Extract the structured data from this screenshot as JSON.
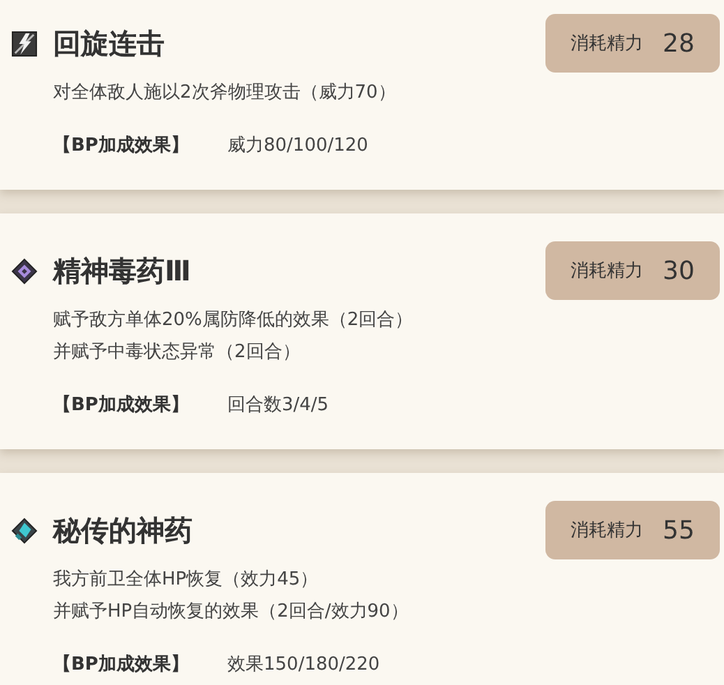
{
  "skills": [
    {
      "kind": "physical",
      "name": "回旋连击",
      "cost_label": "消耗精力",
      "cost": "28",
      "description": [
        "对全体敌人施以2次斧物理攻击（威力70）"
      ],
      "bp_label": "【BP加成效果】",
      "bp_value": "威力80/100/120"
    },
    {
      "kind": "debuff",
      "name": "精神毒药Ⅲ",
      "cost_label": "消耗精力",
      "cost": "30",
      "description": [
        "赋予敌方单体20%属防降低的效果（2回合）",
        "并赋予中毒状态异常（2回合）"
      ],
      "bp_label": "【BP加成效果】",
      "bp_value": "回合数3/4/5"
    },
    {
      "kind": "heal",
      "name": "秘传的神药",
      "cost_label": "消耗精力",
      "cost": "55",
      "description": [
        "我方前卫全体HP恢复（效力45）",
        "并赋予HP自动恢复的效果（2回合/效力90）"
      ],
      "bp_label": "【BP加成效果】",
      "bp_value": "效果150/180/220"
    }
  ]
}
